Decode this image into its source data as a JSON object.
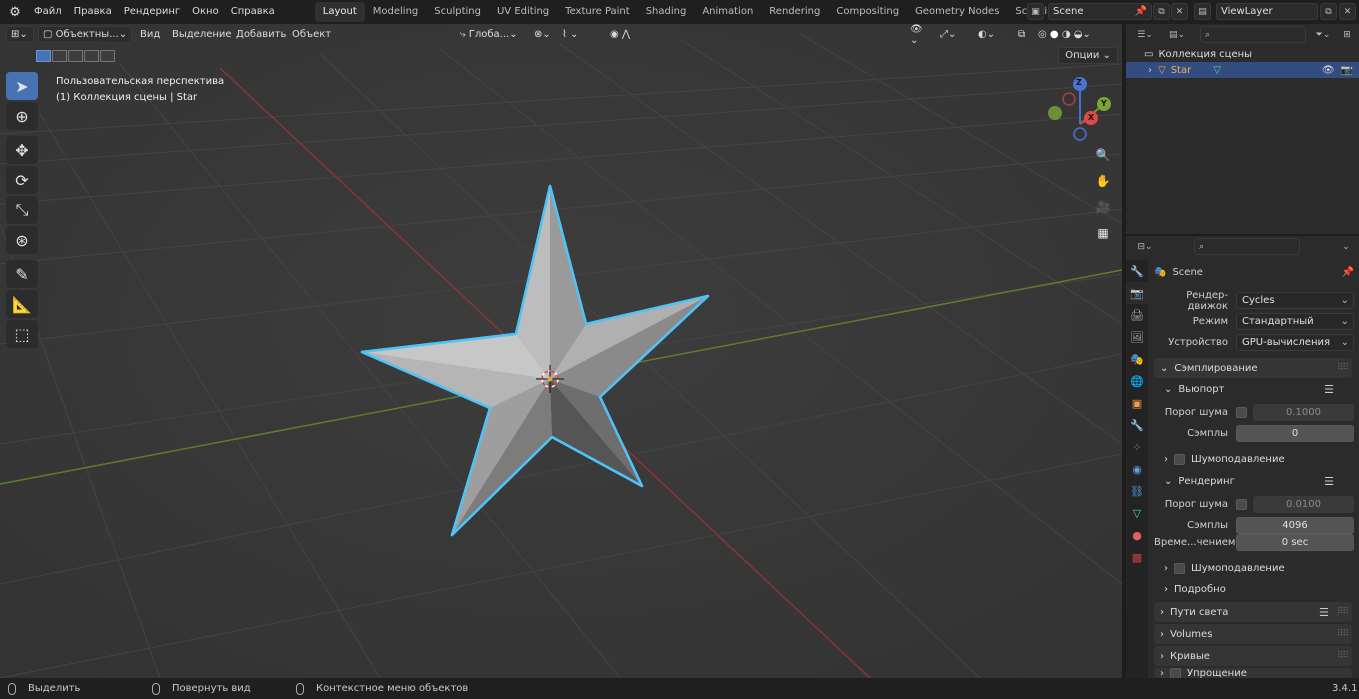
{
  "topbar": {
    "menu": [
      "Файл",
      "Правка",
      "Рендеринг",
      "Окно",
      "Справка"
    ],
    "workspaces": [
      "Layout",
      "Modeling",
      "Sculpting",
      "UV Editing",
      "Texture Paint",
      "Shading",
      "Animation",
      "Rendering",
      "Compositing",
      "Geometry Nodes",
      "Scripting"
    ],
    "active_workspace": "Layout",
    "add_workspace": "+",
    "scene_name": "Scene",
    "view_layer": "ViewLayer"
  },
  "viewport": {
    "mode": "Объектны...",
    "menus": [
      "Вид",
      "Выделение",
      "Добавить",
      "Объект"
    ],
    "transform_orientation": "Глоба...",
    "options_label": "Опции",
    "view_title": "Пользовательская перспектива",
    "view_subtitle": "(1) Коллекция сцены | Star",
    "gizmo_axes": {
      "x": "X",
      "y": "Y",
      "z": "Z"
    },
    "colors": {
      "x_axis": "#9c3a3a",
      "y_axis": "#6a8a2e",
      "selection_outline": "#4fc3f7",
      "star": "#9a9a9a"
    }
  },
  "outliner": {
    "collection": "Коллекция сцены",
    "object": "Star"
  },
  "properties": {
    "scene_label": "Scene",
    "render_engine_label": "Рендер-движок",
    "render_engine": "Cycles",
    "mode_label": "Режим",
    "mode": "Стандартный",
    "device_label": "Устройство",
    "device": "GPU-вычисления",
    "sampling_label": "Сэмплирование",
    "viewport_label": "Вьюпорт",
    "noise_threshold_label": "Порог шума",
    "viewport_noise_threshold": "0.1000",
    "samples_label": "Сэмплы",
    "viewport_samples": "0",
    "denoise_label": "Шумоподавление",
    "render_label": "Рендеринг",
    "render_noise_threshold": "0.0100",
    "render_samples": "4096",
    "time_limit_label": "Време...чением",
    "time_limit": "0 sec",
    "advanced_label": "Подробно",
    "light_paths_label": "Пути света",
    "volumes_label": "Volumes",
    "curves_label": "Кривые",
    "simplify_label": "Упрощение"
  },
  "statusbar": {
    "select": "Выделить",
    "rotate_view": "Повернуть вид",
    "context_menu": "Контекстное меню объектов",
    "version": "3.4.1"
  }
}
